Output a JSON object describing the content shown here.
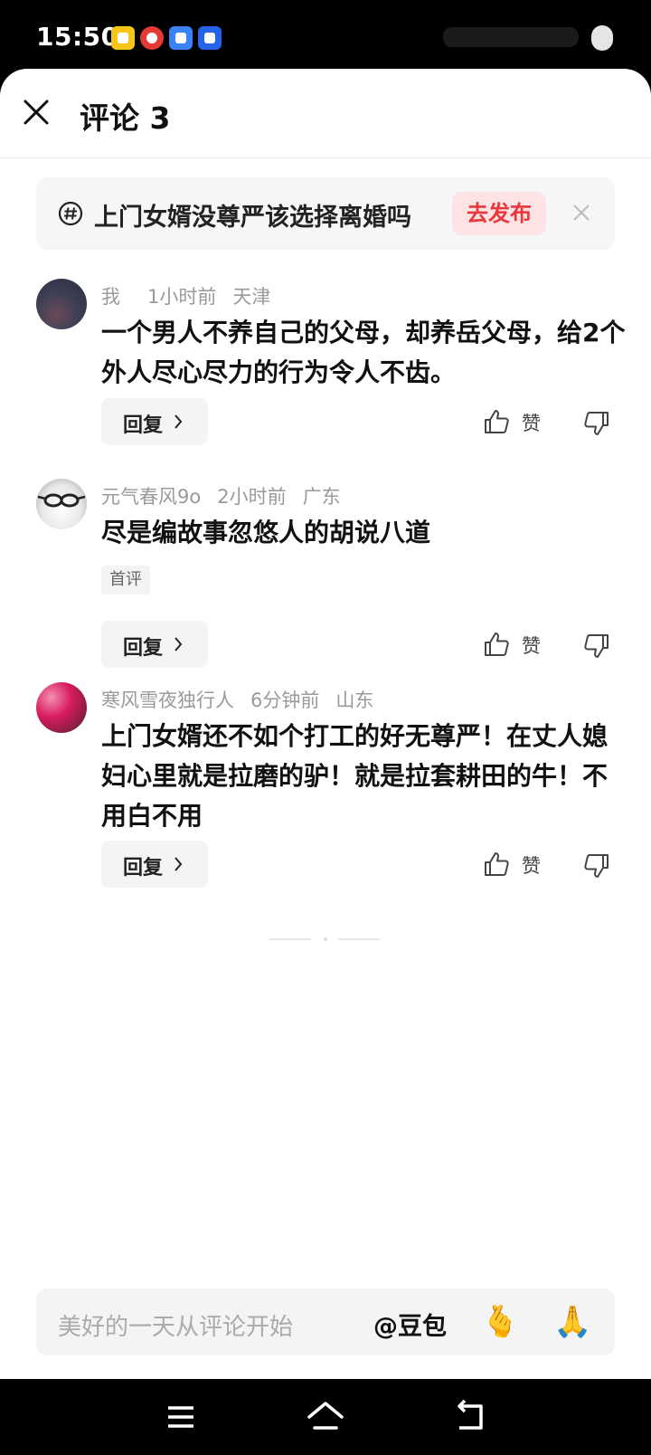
{
  "status_bar": {
    "time": "15:50"
  },
  "header": {
    "title": "评论 3"
  },
  "topic": {
    "text": "上门女婿没尊严该选择离婚吗",
    "publish_label": "去发布"
  },
  "comments": [
    {
      "user": "我",
      "time": "1小时前",
      "location": "天津",
      "body": "一个男人不养自己的父母，却养岳父母，给2个外人尽心尽力的行为令人不齿。",
      "badge": "",
      "reply_label": "回复",
      "like_label": "赞"
    },
    {
      "user": "元气春风9o",
      "time": "2小时前",
      "location": "广东",
      "body": "尽是编故事忽悠人的胡说八道",
      "badge": "首评",
      "reply_label": "回复",
      "like_label": "赞"
    },
    {
      "user": "寒风雪夜独行人",
      "time": "6分钟前",
      "location": "山东",
      "body": "上门女婿还不如个打工的好无尊严！在丈人媳妇心里就是拉磨的驴！就是拉套耕田的牛！不用白不用",
      "badge": "",
      "reply_label": "回复",
      "like_label": "赞"
    }
  ],
  "input": {
    "placeholder": "美好的一天从评论开始",
    "mention": "@豆包",
    "emoji_1": "🫰",
    "emoji_2": "🙏"
  },
  "icons": [
    "close-icon",
    "hashtag-icon",
    "thumb-up-icon",
    "thumb-down-icon",
    "chevron-right-icon",
    "menu-icon",
    "home-icon",
    "back-icon"
  ],
  "colors": {
    "accent": "#e8383d",
    "publish_bg": "#fde3e3"
  }
}
